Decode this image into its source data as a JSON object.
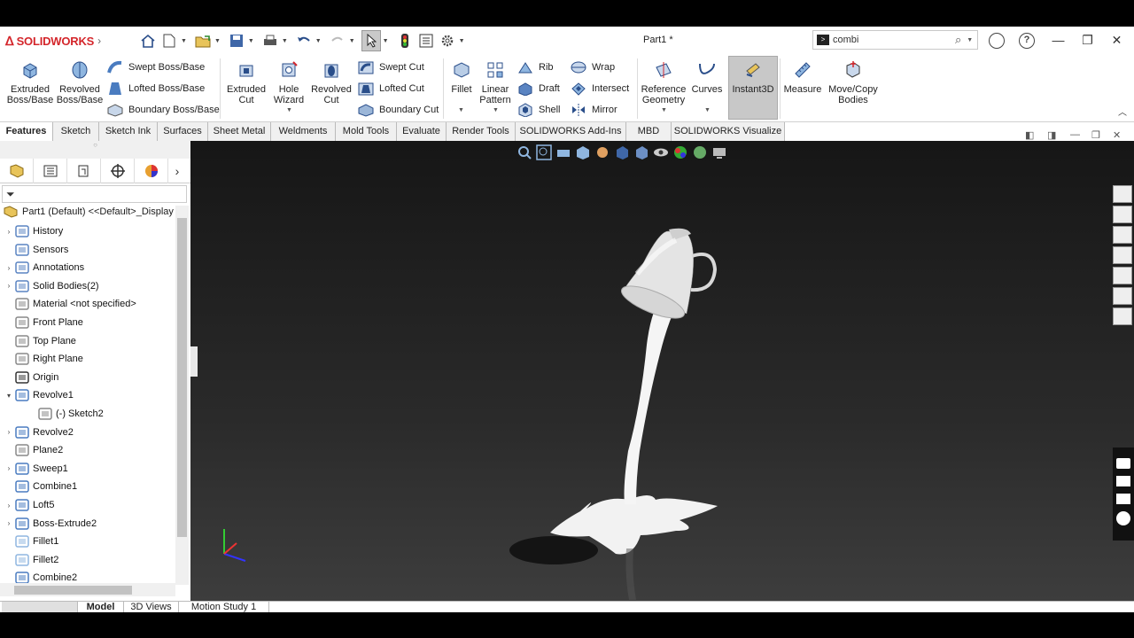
{
  "app": {
    "brand": "SOLIDWORKS",
    "document_title": "Part1 *"
  },
  "search": {
    "value": "combi",
    "icon": "search-icon"
  },
  "ribbon": {
    "extruded_boss": [
      "Extruded",
      "Boss/Base"
    ],
    "revolved_boss": [
      "Revolved",
      "Boss/Base"
    ],
    "swept_boss": "Swept Boss/Base",
    "lofted_boss": "Lofted Boss/Base",
    "boundary_boss": "Boundary Boss/Base",
    "extruded_cut": [
      "Extruded",
      "Cut"
    ],
    "hole_wizard": [
      "Hole",
      "Wizard"
    ],
    "revolved_cut": [
      "Revolved",
      "Cut"
    ],
    "swept_cut": "Swept Cut",
    "lofted_cut": "Lofted Cut",
    "boundary_cut": "Boundary Cut",
    "fillet": "Fillet",
    "linear_pattern": [
      "Linear",
      "Pattern"
    ],
    "rib": "Rib",
    "draft": "Draft",
    "shell": "Shell",
    "wrap": "Wrap",
    "intersect": "Intersect",
    "mirror": "Mirror",
    "reference_geometry": [
      "Reference",
      "Geometry"
    ],
    "curves": "Curves",
    "instant3d": "Instant3D",
    "measure": "Measure",
    "move_copy": [
      "Move/Copy",
      "Bodies"
    ]
  },
  "tabs": [
    "Features",
    "Sketch",
    "Sketch Ink",
    "Surfaces",
    "Sheet Metal",
    "Weldments",
    "Mold Tools",
    "Evaluate",
    "Render Tools",
    "SOLIDWORKS Add-Ins",
    "MBD",
    "SOLIDWORKS Visualize"
  ],
  "tree": {
    "part_label": "Part1 (Default) <<Default>_Display",
    "nodes": [
      {
        "label": "History",
        "icon": "history-icon",
        "expandable": true
      },
      {
        "label": "Sensors",
        "icon": "sensor-icon",
        "expandable": false
      },
      {
        "label": "Annotations",
        "icon": "annotations-icon",
        "expandable": true
      },
      {
        "label": "Solid Bodies(2)",
        "icon": "solid-bodies-icon",
        "expandable": true
      },
      {
        "label": "Material <not specified>",
        "icon": "material-icon",
        "expandable": false
      },
      {
        "label": "Front Plane",
        "icon": "plane-icon",
        "expandable": false
      },
      {
        "label": "Top Plane",
        "icon": "plane-icon",
        "expandable": false
      },
      {
        "label": "Right Plane",
        "icon": "plane-icon",
        "expandable": false
      },
      {
        "label": "Origin",
        "icon": "origin-icon",
        "expandable": false
      },
      {
        "label": "Revolve1",
        "icon": "revolve-icon",
        "expandable": true,
        "expanded": true
      },
      {
        "label": "(-) Sketch2",
        "icon": "sketch-icon",
        "expandable": false,
        "child": true
      },
      {
        "label": "Revolve2",
        "icon": "revolve-icon",
        "expandable": true
      },
      {
        "label": "Plane2",
        "icon": "plane-icon",
        "expandable": false
      },
      {
        "label": "Sweep1",
        "icon": "sweep-icon",
        "expandable": true
      },
      {
        "label": "Combine1",
        "icon": "combine-icon",
        "expandable": false
      },
      {
        "label": "Loft5",
        "icon": "loft-icon",
        "expandable": true
      },
      {
        "label": "Boss-Extrude2",
        "icon": "extrude-icon",
        "expandable": true
      },
      {
        "label": "Fillet1",
        "icon": "fillet-icon",
        "expandable": false
      },
      {
        "label": "Fillet2",
        "icon": "fillet-icon",
        "expandable": false
      },
      {
        "label": "Combine2",
        "icon": "combine-icon",
        "expandable": false
      }
    ]
  },
  "status_tabs": [
    "Model",
    "3D Views",
    "Motion Study 1"
  ],
  "colors": {
    "accent": "#d4262b",
    "viewport_top": "#161616",
    "viewport_bottom": "#3d3d3d",
    "model": "#ffffff"
  }
}
